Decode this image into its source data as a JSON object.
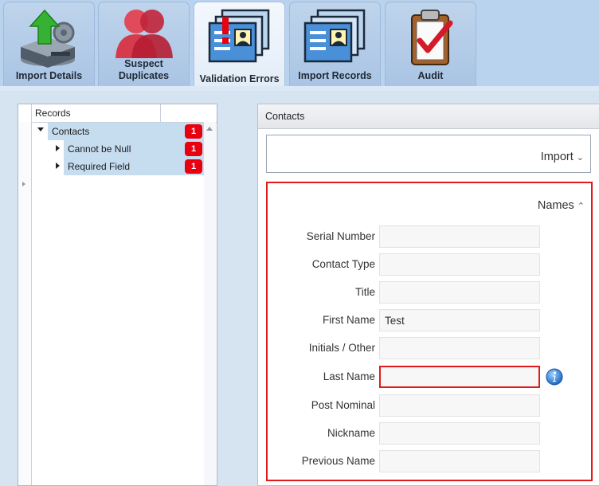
{
  "tabs": [
    {
      "label": "Import Details",
      "icon": "import-database-icon",
      "active": false
    },
    {
      "label": "Suspect\nDuplicates",
      "icon": "duplicate-users-icon",
      "active": false
    },
    {
      "label": "Validation Errors",
      "icon": "validation-error-icon",
      "active": true
    },
    {
      "label": "Import Records",
      "icon": "import-records-icon",
      "active": false
    },
    {
      "label": "Audit",
      "icon": "audit-clipboard-icon",
      "active": false
    }
  ],
  "tree": {
    "header": "Records",
    "rows": [
      {
        "label": "Contacts",
        "count": "1",
        "expanded": true
      },
      {
        "label": "Cannot be Null",
        "count": "1",
        "expanded": false
      },
      {
        "label": "Required Field",
        "count": "1",
        "expanded": false
      }
    ]
  },
  "panel": {
    "title": "Contacts",
    "import_section": "Import",
    "names_section": "Names"
  },
  "fields": [
    {
      "label": "Serial Number",
      "value": ""
    },
    {
      "label": "Contact Type",
      "value": ""
    },
    {
      "label": "Title",
      "value": ""
    },
    {
      "label": "First Name",
      "value": "Test"
    },
    {
      "label": "Initials / Other",
      "value": ""
    },
    {
      "label": "Last Name",
      "value": "",
      "error": true
    },
    {
      "label": "Post Nominal",
      "value": ""
    },
    {
      "label": "Nickname",
      "value": ""
    },
    {
      "label": "Previous Name",
      "value": ""
    }
  ],
  "colors": {
    "error": "#e01b1b",
    "badge": "#e8000f",
    "highlight": "#c6dcef"
  }
}
